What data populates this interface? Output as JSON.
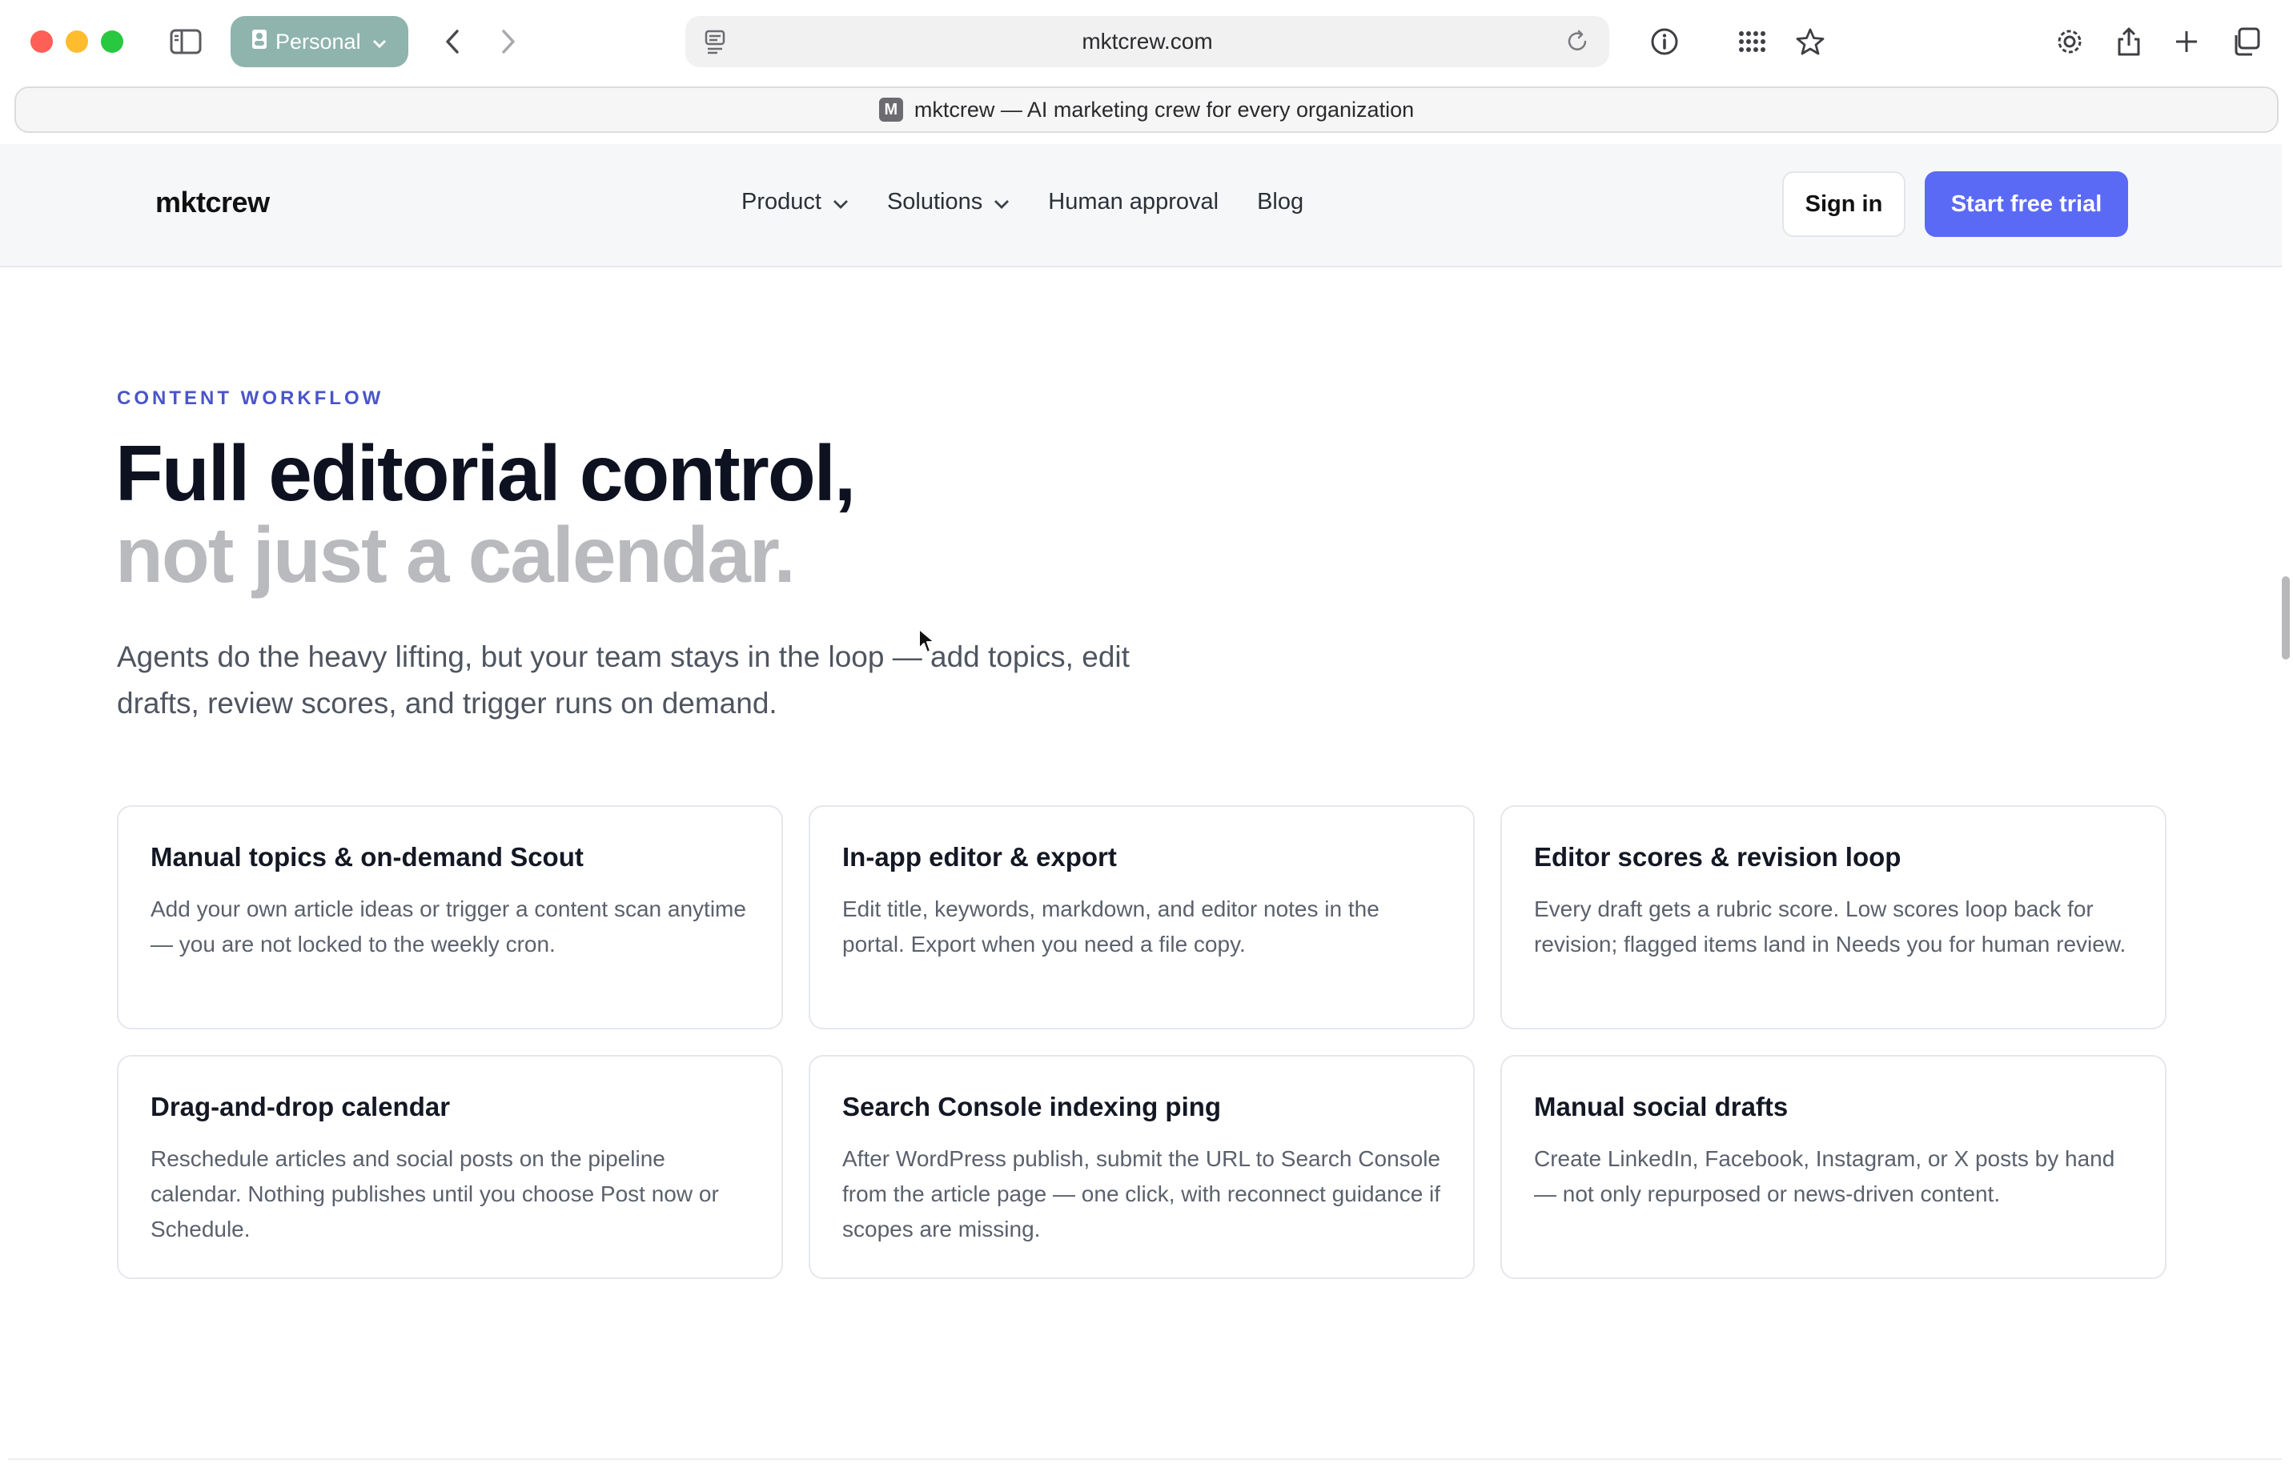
{
  "browser": {
    "profile_label": "Personal",
    "url": "mktcrew.com",
    "tab_favicon_letter": "M",
    "tab_title": "mktcrew — AI marketing crew for every organization",
    "icons": [
      "sidebar-icon",
      "person-icon",
      "back-icon",
      "forward-icon",
      "reader-icon",
      "reload-icon",
      "info-icon",
      "grid-icon",
      "star-icon",
      "gear-icon",
      "share-icon",
      "plus-icon",
      "tabs-icon"
    ]
  },
  "header": {
    "logo": "mktcrew",
    "nav": [
      {
        "label": "Product"
      },
      {
        "label": "Solutions"
      },
      {
        "label": "Human approval"
      },
      {
        "label": "Blog"
      }
    ],
    "signin_label": "Sign in",
    "trial_label": "Start free trial"
  },
  "section": {
    "eyebrow": "CONTENT WORKFLOW",
    "headline_line1": "Full editorial control,",
    "headline_line2": "not just a calendar.",
    "lead": "Agents do the heavy lifting, but your team stays in the loop — add topics, edit drafts, review scores, and trigger runs on demand."
  },
  "cards": [
    {
      "title": "Manual topics & on-demand Scout",
      "desc": "Add your own article ideas or trigger a content scan anytime — you are not locked to the weekly cron."
    },
    {
      "title": "In-app editor & export",
      "desc": "Edit title, keywords, markdown, and editor notes in the portal. Export when you need a file copy."
    },
    {
      "title": "Editor scores & revision loop",
      "desc": "Every draft gets a rubric score. Low scores loop back for revision; flagged items land in Needs you for human review."
    },
    {
      "title": "Drag-and-drop calendar",
      "desc": "Reschedule articles and social posts on the pipeline calendar. Nothing publishes until you choose Post now or Schedule."
    },
    {
      "title": "Search Console indexing ping",
      "desc": "After WordPress publish, submit the URL to Search Console from the article page — one click, with reconnect guidance if scopes are missing."
    },
    {
      "title": "Manual social drafts",
      "desc": "Create LinkedIn, Facebook, Instagram, or X posts by hand — not only repurposed or news-driven content."
    }
  ],
  "colors": {
    "accent": "#5b6af5",
    "eyebrow": "#4a55c9",
    "headline_muted": "#b9babd"
  }
}
